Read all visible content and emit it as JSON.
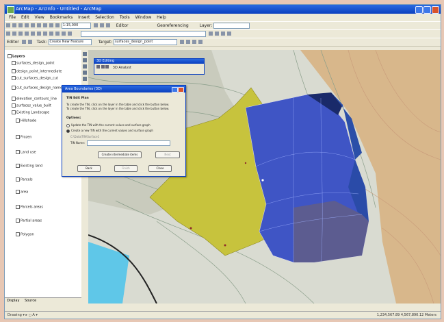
{
  "window": {
    "title": "ArcMap - ArcInfo - Untitled - ArcMap"
  },
  "menu": [
    "File",
    "Edit",
    "View",
    "Bookmarks",
    "Insert",
    "Selection",
    "Tools",
    "Window",
    "Help"
  ],
  "toolbar1": {
    "scale": "1:15,000",
    "editor_label": "Editor",
    "georef": "Georeferencing",
    "layer_label": "Layer:"
  },
  "toolbar2": {
    "task_label": "Task:",
    "task_value": "Create New Feature",
    "target_label": "Target:",
    "target_value": "surfaces_design_point"
  },
  "toc": {
    "items": [
      "Layers",
      "surfaces_design_point",
      "design_point_intermediate",
      "cut_surfaces_design_cut",
      "cut_surfaces_design_name_",
      "elevation_contours_line",
      "surfaces_value_built",
      "Existing Landscape",
      "Hillshade",
      "Frozen",
      "Land use",
      "Existing land",
      "Parcels",
      "area",
      "Parcels areas",
      "Partial areas",
      "Polygon"
    ],
    "tab_display": "Display",
    "tab_source": "Source"
  },
  "edit_window": {
    "title": "3D Editing",
    "label": "3D Analyst"
  },
  "dialog": {
    "title": "Area Boundaries (3D)",
    "heading": "TIN Edit Plan",
    "line1": "To create the TIN, click on the layer in the table and click the button below.",
    "line2": "To create the TIN, click on the layer in the table and click the button below.",
    "options_label": "Options:",
    "opt1": "Update the TIN with the current values and surface graph",
    "opt2": "Create a new TIN with the current values and surface graph",
    "path_text": "C:\\Data\\TIN\\Surface1",
    "tin_name_label": "TIN Name:",
    "create_label": "Create intermediate items",
    "next_label": "Next",
    "back_label": "Back",
    "finish_label": "Finish",
    "close_label": "Close"
  },
  "status": {
    "coords": "1,234,567.89  4,567,890.12 Meters"
  },
  "colors": {
    "selection_blue": "#3e55c4",
    "yellow_poly": "#c6c23e",
    "terrain": "#d4b48a"
  }
}
